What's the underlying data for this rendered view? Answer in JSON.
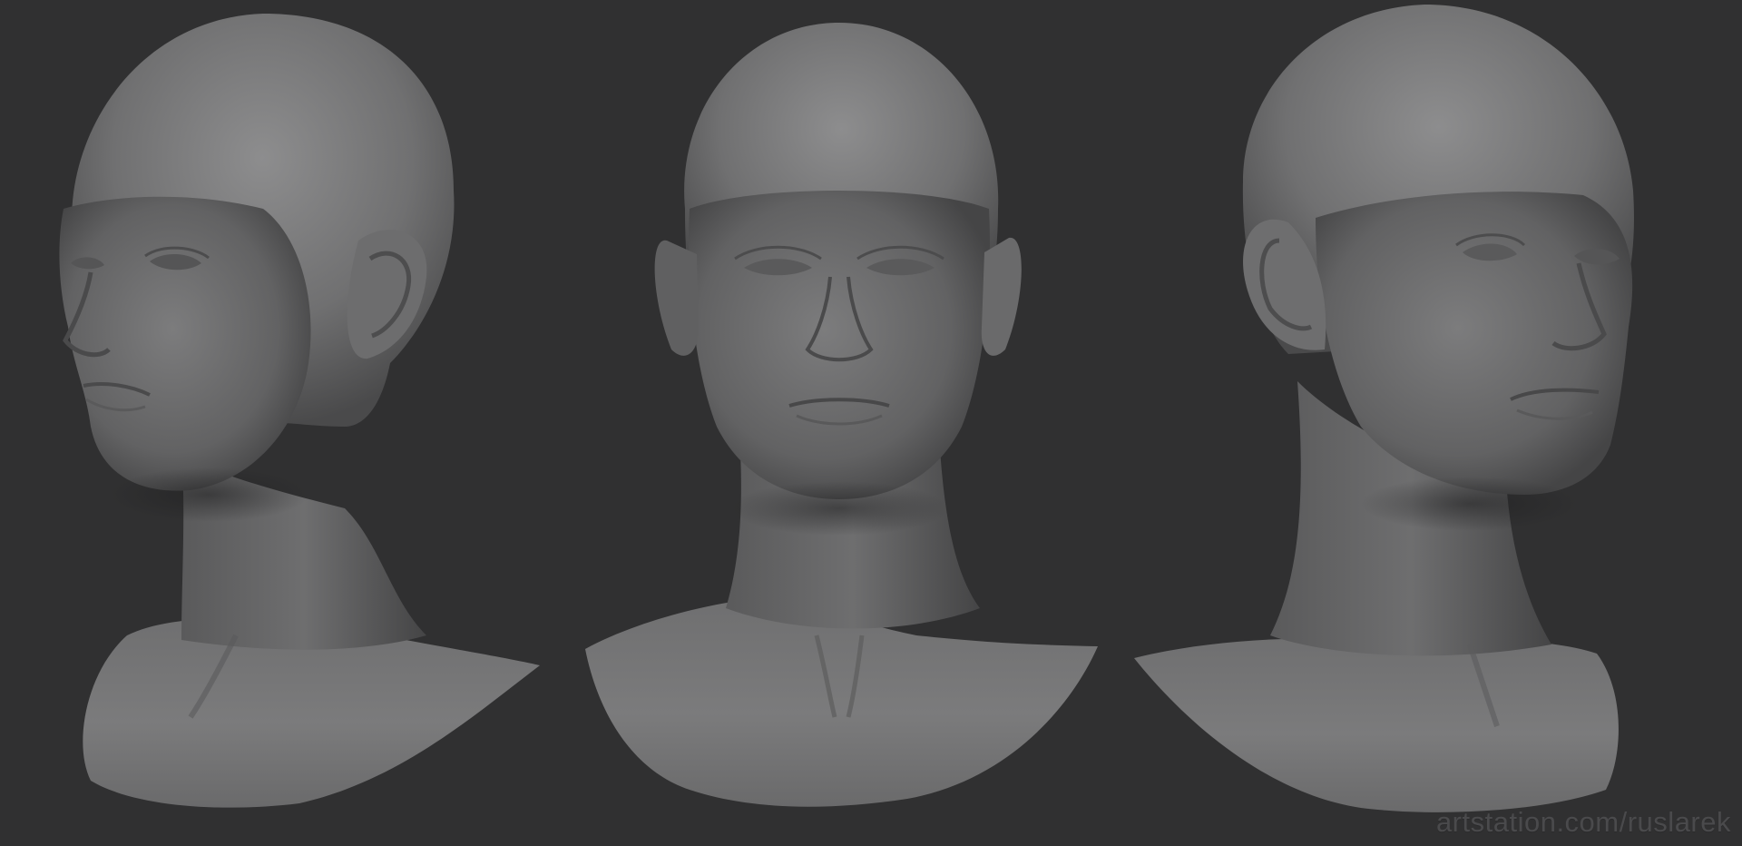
{
  "scene": {
    "background_color": "#303031",
    "clay_color": "#7a7a7b",
    "views": [
      {
        "name": "three-quarter-left"
      },
      {
        "name": "front"
      },
      {
        "name": "three-quarter-right"
      }
    ]
  },
  "watermark": {
    "text": "artstation.com/ruslarek"
  }
}
